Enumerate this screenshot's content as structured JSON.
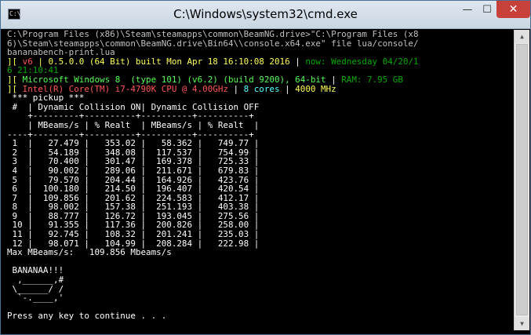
{
  "window": {
    "title": "C:\\Windows\\system32\\cmd.exe",
    "icon_label": "C:\\",
    "minimize_glyph": "—",
    "maximize_glyph": "☐",
    "close_glyph": "✕"
  },
  "console": {
    "command_lines": [
      "C:\\Program Files (x86)\\Steam\\steamapps\\common\\BeamNG.drive>\"C:\\Program Files (x8",
      "6)\\Steam\\steamapps\\common\\BeamNG.drive\\Bin64\\\\console.x64.exe\" file lua/console/",
      "bananabench-print.lua"
    ],
    "info": {
      "v6_prefix": "][ ",
      "v6_label": "v6",
      "v6_sep": " | ",
      "version": "0.5.0.0 (64 Bit) built Mon Apr 18 16:10:08 2016",
      "now_sep": " | ",
      "now_text": "now: Wednesday 04/20/1",
      "now_cont": "6 21:10:41",
      "os_prefix": "][ ",
      "os_text": "Microsoft Windows 8  (type 101) (v6.2) (build 9200), 64-bit",
      "ram_sep": " | ",
      "ram_text": "RAM: 7.95 GB",
      "cpu_prefix": "][ ",
      "cpu_text": "Intel(R) Core(TM) i7-4790K CPU @ 4.00GHz",
      "cores_sep": " | ",
      "cores_text": "8 cores",
      "mhz_sep": " | ",
      "mhz_text": "4000 MHz"
    },
    "table_lines": [
      " *** pickup ***",
      " #  | Dynamic Collision ON| Dynamic Collision OFF",
      "    +---------+----------+----------+----------+",
      "    | MBeams/s | % Realt  | MBeams/s | % Realt  |",
      "----+---------+----------+----------+----------+",
      " 1  |   27.479 |   353.02 |   58.362 |   749.77 |",
      " 2  |   54.189 |   348.08 |  117.537 |   754.99 |",
      " 3  |   70.400 |   301.47 |  169.378 |   725.33 |",
      " 4  |   90.002 |   289.06 |  211.671 |   679.83 |",
      " 5  |   79.570 |   204.44 |  164.926 |   423.76 |",
      " 6  |  100.180 |   214.50 |  196.407 |   420.54 |",
      " 7  |  109.856 |   201.62 |  224.583 |   412.17 |",
      " 8  |   98.002 |   157.38 |  251.193 |   403.38 |",
      " 9  |   88.777 |   126.72 |  193.045 |   275.56 |",
      " 10 |   91.355 |   117.36 |  200.826 |   258.00 |",
      " 11 |   92.745 |   108.32 |  201.241 |   235.03 |",
      " 12 |   98.071 |   104.99 |  208.284 |   222.98 |",
      "Max MBeams/s:   109.856 Mbeams/s",
      "",
      " BANANAA!!!",
      "  ,______,#",
      " \\______/ /",
      "  `-.____,'",
      "",
      "Press any key to continue . . ."
    ]
  },
  "scrollbar": {
    "up_glyph": "▲",
    "down_glyph": "▼"
  }
}
